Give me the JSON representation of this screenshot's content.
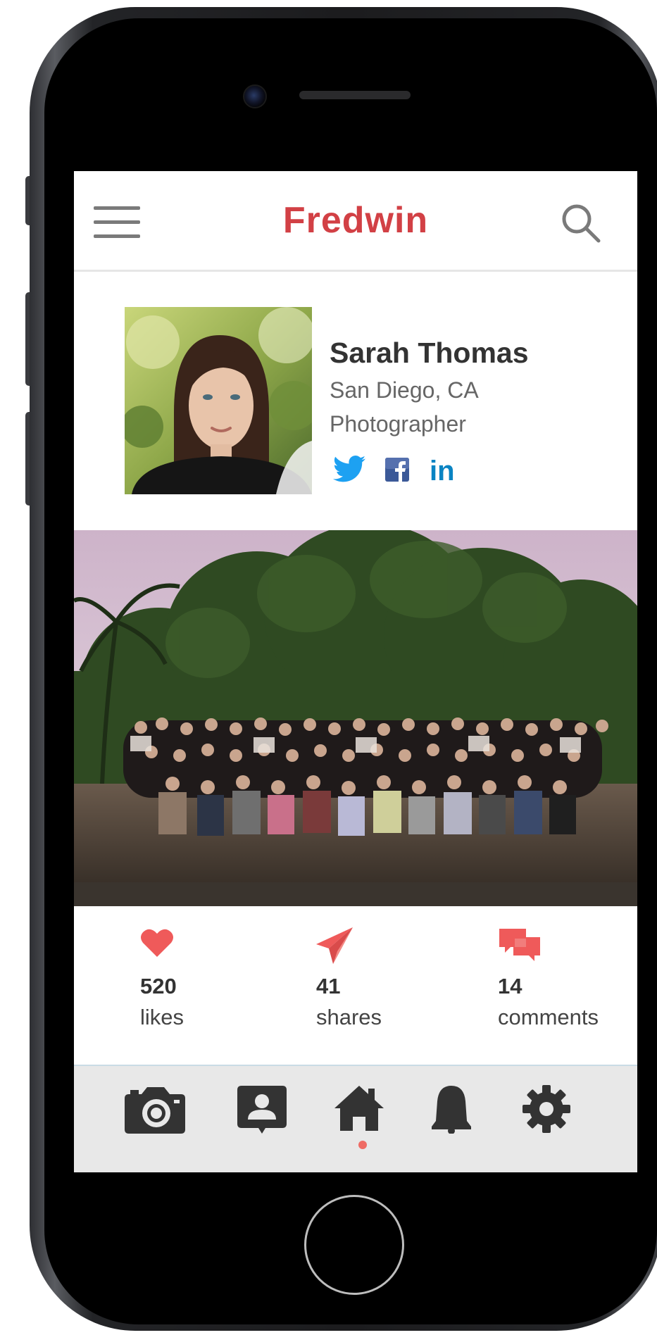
{
  "app": {
    "brand": "Fredwin",
    "accent_color": "#d24045",
    "icon_color": "#ef6b64"
  },
  "header": {
    "menu_icon": "hamburger-menu-icon",
    "search_icon": "search-icon"
  },
  "profile": {
    "name": "Sarah Thomas",
    "location": "San Diego, CA",
    "occupation": "Photographer",
    "avatar": "profile-photo",
    "social": [
      {
        "network": "twitter",
        "icon": "twitter-icon",
        "color": "#1da1f2"
      },
      {
        "network": "facebook",
        "icon": "facebook-icon",
        "color": "#3b5998"
      },
      {
        "network": "linkedin",
        "icon": "linkedin-icon",
        "glyph": "in",
        "color": "#0a84c3"
      }
    ]
  },
  "post": {
    "image": "group-photo"
  },
  "stats": [
    {
      "icon": "heart-icon",
      "count": "520",
      "label": "likes"
    },
    {
      "icon": "paper-plane-icon",
      "count": "41",
      "label": "shares"
    },
    {
      "icon": "chat-bubbles-icon",
      "count": "14",
      "label": "comments"
    }
  ],
  "tabbar": {
    "items": [
      {
        "icon": "camera-icon"
      },
      {
        "icon": "contact-card-icon"
      },
      {
        "icon": "home-icon",
        "active": true
      },
      {
        "icon": "bell-icon"
      },
      {
        "icon": "gear-icon"
      }
    ],
    "active_index": 2
  }
}
